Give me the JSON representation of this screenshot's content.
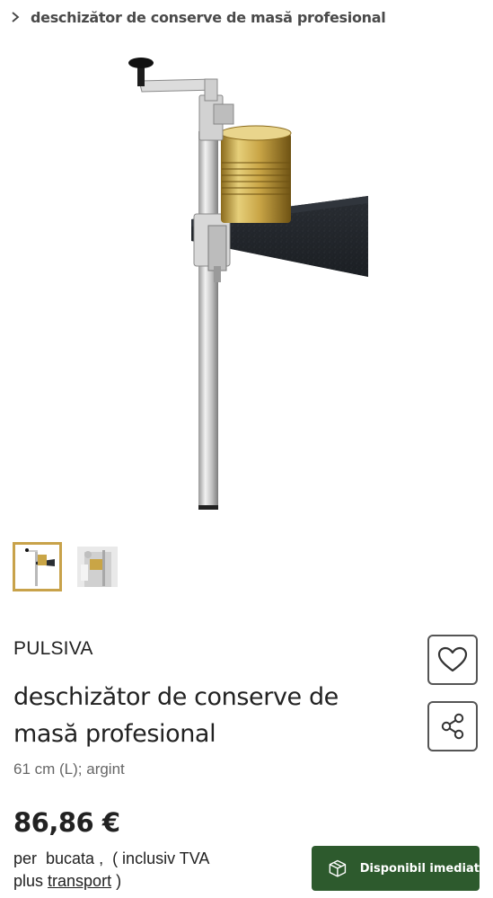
{
  "breadcrumb": {
    "label": "deschizător de conserve de masă profesional"
  },
  "gallery": {
    "thumbnails": [
      "product-photo",
      "in-use-photo"
    ],
    "active_index": 0
  },
  "product": {
    "brand": "PULSIVA",
    "title": "deschizător de conserve de masă profesional",
    "variant": "61 cm (L); argint",
    "price": "86,86 €",
    "price_unit_line": "per  bucata ,  ( inclusiv TVA",
    "price_shipping_prefix": "plus ",
    "price_shipping_link": "transport",
    "price_shipping_suffix": " )",
    "availability": "Disponibil imediat"
  },
  "actions": {
    "wishlist_icon": "heart-icon",
    "share_icon": "share-icon"
  },
  "colors": {
    "accent_gold": "#c8a24a",
    "availability_bg": "#2d5a2d",
    "text_primary": "#222222",
    "text_muted": "#666666"
  }
}
